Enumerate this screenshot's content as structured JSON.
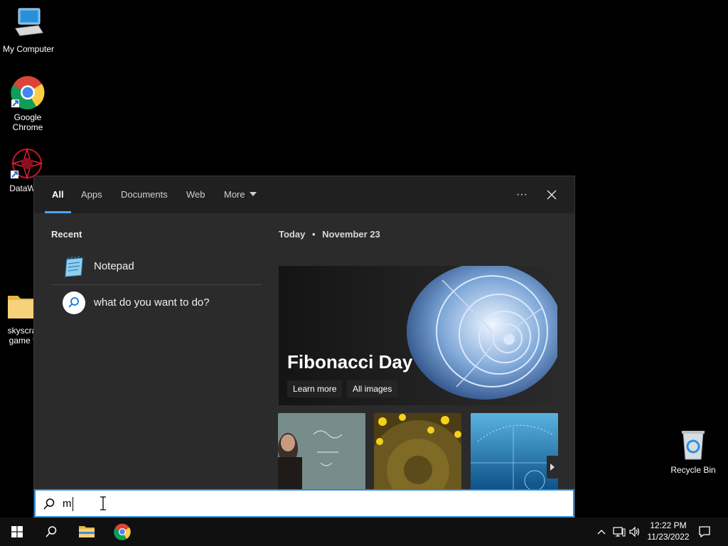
{
  "desktop": {
    "icons": [
      {
        "name": "My Computer"
      },
      {
        "name": "Google Chrome"
      },
      {
        "name": "DataWag"
      },
      {
        "name": "skyscra game f"
      },
      {
        "name": "Recycle Bin"
      }
    ]
  },
  "search_panel": {
    "tabs": [
      {
        "label": "All",
        "active": true
      },
      {
        "label": "Apps"
      },
      {
        "label": "Documents"
      },
      {
        "label": "Web"
      },
      {
        "label": "More"
      }
    ],
    "more_options_label": "···",
    "recent": {
      "title": "Recent",
      "items": [
        {
          "label": "Notepad",
          "icon": "notepad-icon"
        },
        {
          "label": "what do you want to do?",
          "icon": "search-icon"
        }
      ]
    },
    "today": {
      "label": "Today",
      "separator": "•",
      "date": "November 23"
    },
    "hero": {
      "title": "Fibonacci Day",
      "buttons": [
        "Learn more",
        "All images"
      ]
    }
  },
  "searchbox": {
    "value": "m"
  },
  "taskbar": {
    "time": "12:22 PM",
    "date": "11/23/2022"
  },
  "colors": {
    "accent": "#4aa3ff",
    "panel_bg": "#2b2b2b",
    "tabs_bg": "#202020",
    "search_border": "#2b8bd6"
  }
}
